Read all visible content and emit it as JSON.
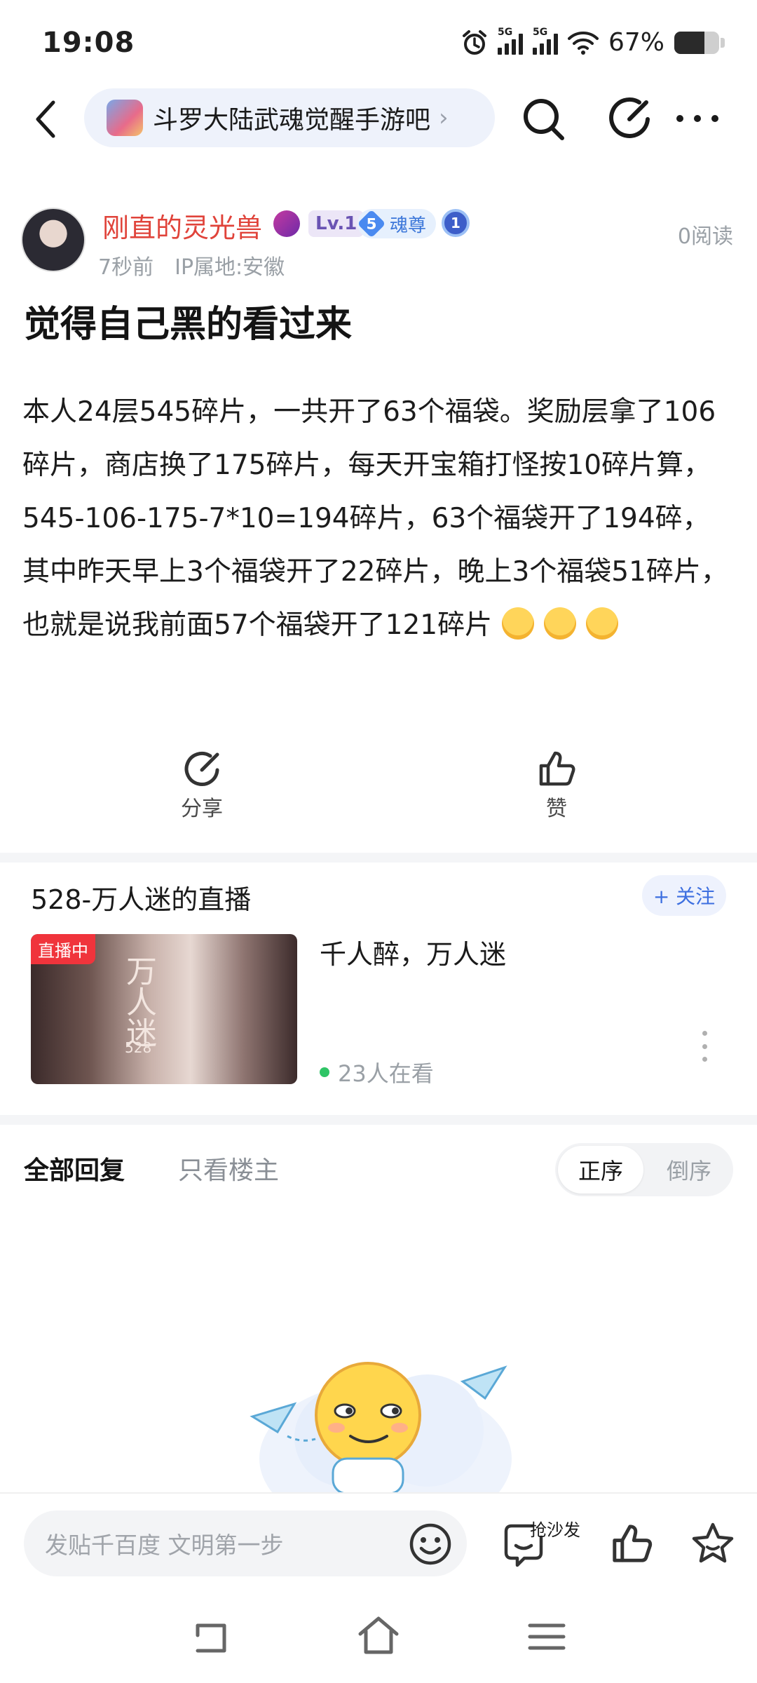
{
  "status_bar": {
    "time": "19:08",
    "network1": "5G",
    "network2": "5G",
    "battery": "67%",
    "battery_level": 0.67
  },
  "header": {
    "forum_name": "斗罗大陆武魂觉醒手游吧",
    "forum_chevron": "›"
  },
  "author": {
    "name": "刚直的灵光兽",
    "level": "Lv.1",
    "rank_number": "5",
    "rank_title": "魂尊",
    "medal_number": "1",
    "time": "7秒前",
    "ip": "IP属地:安徽",
    "read_count": "0阅读"
  },
  "post": {
    "title": "觉得自己黑的看过来",
    "body": "本人24层545碎片，一共开了63个福袋。奖励层拿了106碎片，商店换了175碎片，每天开宝箱打怪按10碎片算，545-106-175-7*10=194碎片，63个福袋开了194碎，其中昨天早上3个福袋开了22碎片，晚上3个福袋51碎片，也就是说我前面57个福袋开了121碎片"
  },
  "actions": {
    "share": "分享",
    "like": "赞"
  },
  "live": {
    "streamer_title": "528-万人迷的直播",
    "follow": "+ 关注",
    "badge": "直播中",
    "thumb_text": "万人迷",
    "thumb_sub": "528",
    "headline": "千人醉，万人迷",
    "viewers": "23人在看"
  },
  "replies": {
    "tab_all": "全部回复",
    "tab_owner": "只看楼主",
    "sort_asc": "正序",
    "sort_desc": "倒序"
  },
  "comment_bar": {
    "placeholder": "发贴千百度 文明第一步",
    "sofa": "抢沙发"
  },
  "icons": {
    "back": "back-arrow-icon",
    "search": "search-icon",
    "edit": "edit-icon",
    "more": "more-icon",
    "share": "share-icon",
    "like": "thumbs-up-icon",
    "emoji": "emoji-icon",
    "sofa": "comment-icon",
    "favorite": "star-icon"
  },
  "colors": {
    "author_name": "#e0433a",
    "accent_blue": "#3d6fe0",
    "live_red": "#f0343c",
    "live_green": "#2fc466"
  }
}
